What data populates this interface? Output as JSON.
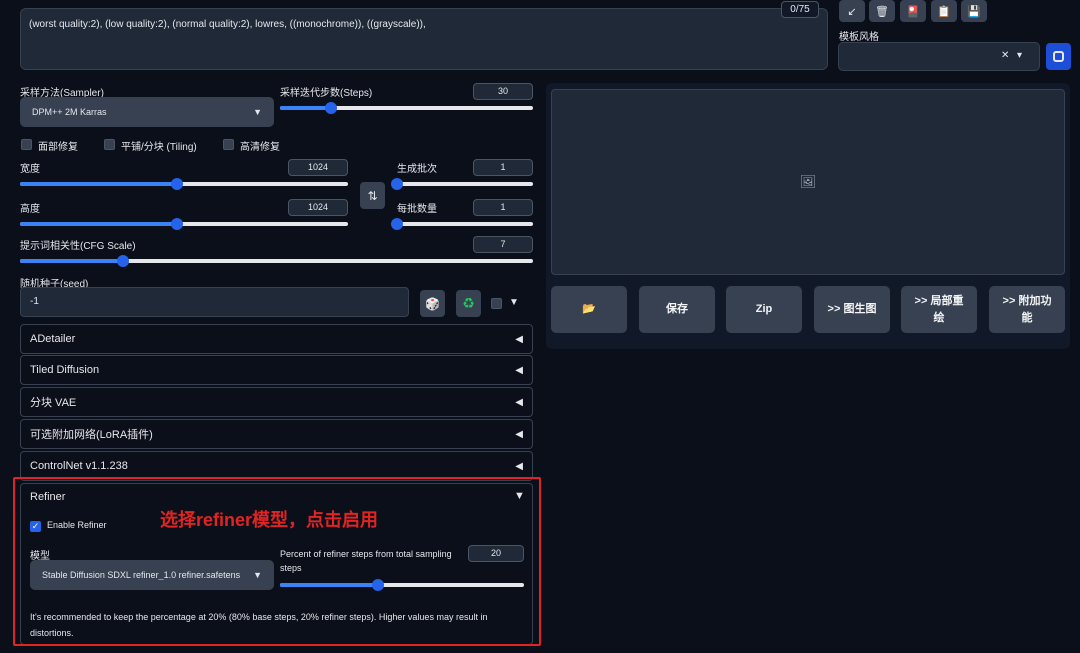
{
  "negative_prompt": {
    "text": "(worst quality:2), (low quality:2), (normal quality:2), lowres, ((monochrome)), ((grayscale)),",
    "token_count": "0/75"
  },
  "toolbar": {
    "icons": [
      "arrow-icon",
      "trash-icon",
      "card-icon",
      "clipboard-icon",
      "save-icon"
    ],
    "glyphs": [
      "↙",
      "🗑",
      "🎴",
      "📋",
      "💾"
    ]
  },
  "styles": {
    "label": "模板风格",
    "clear_glyph": "✕",
    "arrow_glyph": "▾"
  },
  "sampler": {
    "label": "采样方法(Sampler)",
    "value": "DPM++ 2M Karras"
  },
  "steps": {
    "label": "采样迭代步数(Steps)",
    "value": "30",
    "fraction": 0.2
  },
  "checkboxes": [
    {
      "label": "面部修复"
    },
    {
      "label": "平铺/分块 (Tiling)"
    },
    {
      "label": "高清修复"
    }
  ],
  "width": {
    "label": "宽度",
    "value": "1024",
    "fraction": 0.48
  },
  "height": {
    "label": "高度",
    "value": "1024",
    "fraction": 0.48
  },
  "swap_glyph": "⇅",
  "batch_count": {
    "label": "生成批次",
    "value": "1",
    "fraction": 0.0
  },
  "batch_size": {
    "label": "每批数量",
    "value": "1",
    "fraction": 0.0
  },
  "cfg": {
    "label": "提示词相关性(CFG Scale)",
    "value": "7",
    "fraction": 0.2
  },
  "seed": {
    "label": "随机种子(seed)",
    "value": "-1",
    "dice_glyph": "🎲",
    "recycle_glyph": "♻",
    "extra_arrow": "▼"
  },
  "panels": [
    {
      "label": "ADetailer",
      "arrow": "◀"
    },
    {
      "label": "Tiled Diffusion",
      "arrow": "◀"
    },
    {
      "label": "分块 VAE",
      "arrow": "◀"
    },
    {
      "label": "可选附加网络(LoRA插件)",
      "arrow": "◀"
    },
    {
      "label": "ControlNet v1.1.238",
      "arrow": "◀"
    }
  ],
  "refiner": {
    "title": "Refiner",
    "arrow": "▼",
    "enable_label": "Enable Refiner",
    "enabled": true,
    "model_label": "模型",
    "model_value": "Stable Diffusion SDXL refiner_1.0 refiner.safetens",
    "percent_label_line1": "Percent of refiner steps from total sampling",
    "percent_label_line2": "steps",
    "percent_value": "20",
    "percent_fraction": 0.4,
    "note_line1": "It's recommended to keep the percentage at 20% (80% base steps, 20% refiner steps). Higher values may result in",
    "note_line2": "distortions.",
    "annotation": "选择refiner模型，点击启用",
    "annotation_color": "#e02424"
  },
  "output": {
    "image_icon": "🖼",
    "buttons": [
      {
        "name": "open-folder-button",
        "line1": "📂",
        "line2": ""
      },
      {
        "name": "save-button",
        "line1": "保存",
        "line2": ""
      },
      {
        "name": "zip-button",
        "line1": "Zip",
        "line2": ""
      },
      {
        "name": "send-to-img2img-button",
        "line1": ">> 图生图",
        "line2": ""
      },
      {
        "name": "send-to-inpaint-button",
        "line1": ">> 局部重",
        "line2": "绘"
      },
      {
        "name": "send-to-extras-button",
        "line1": ">> 附加功",
        "line2": "能"
      }
    ]
  }
}
